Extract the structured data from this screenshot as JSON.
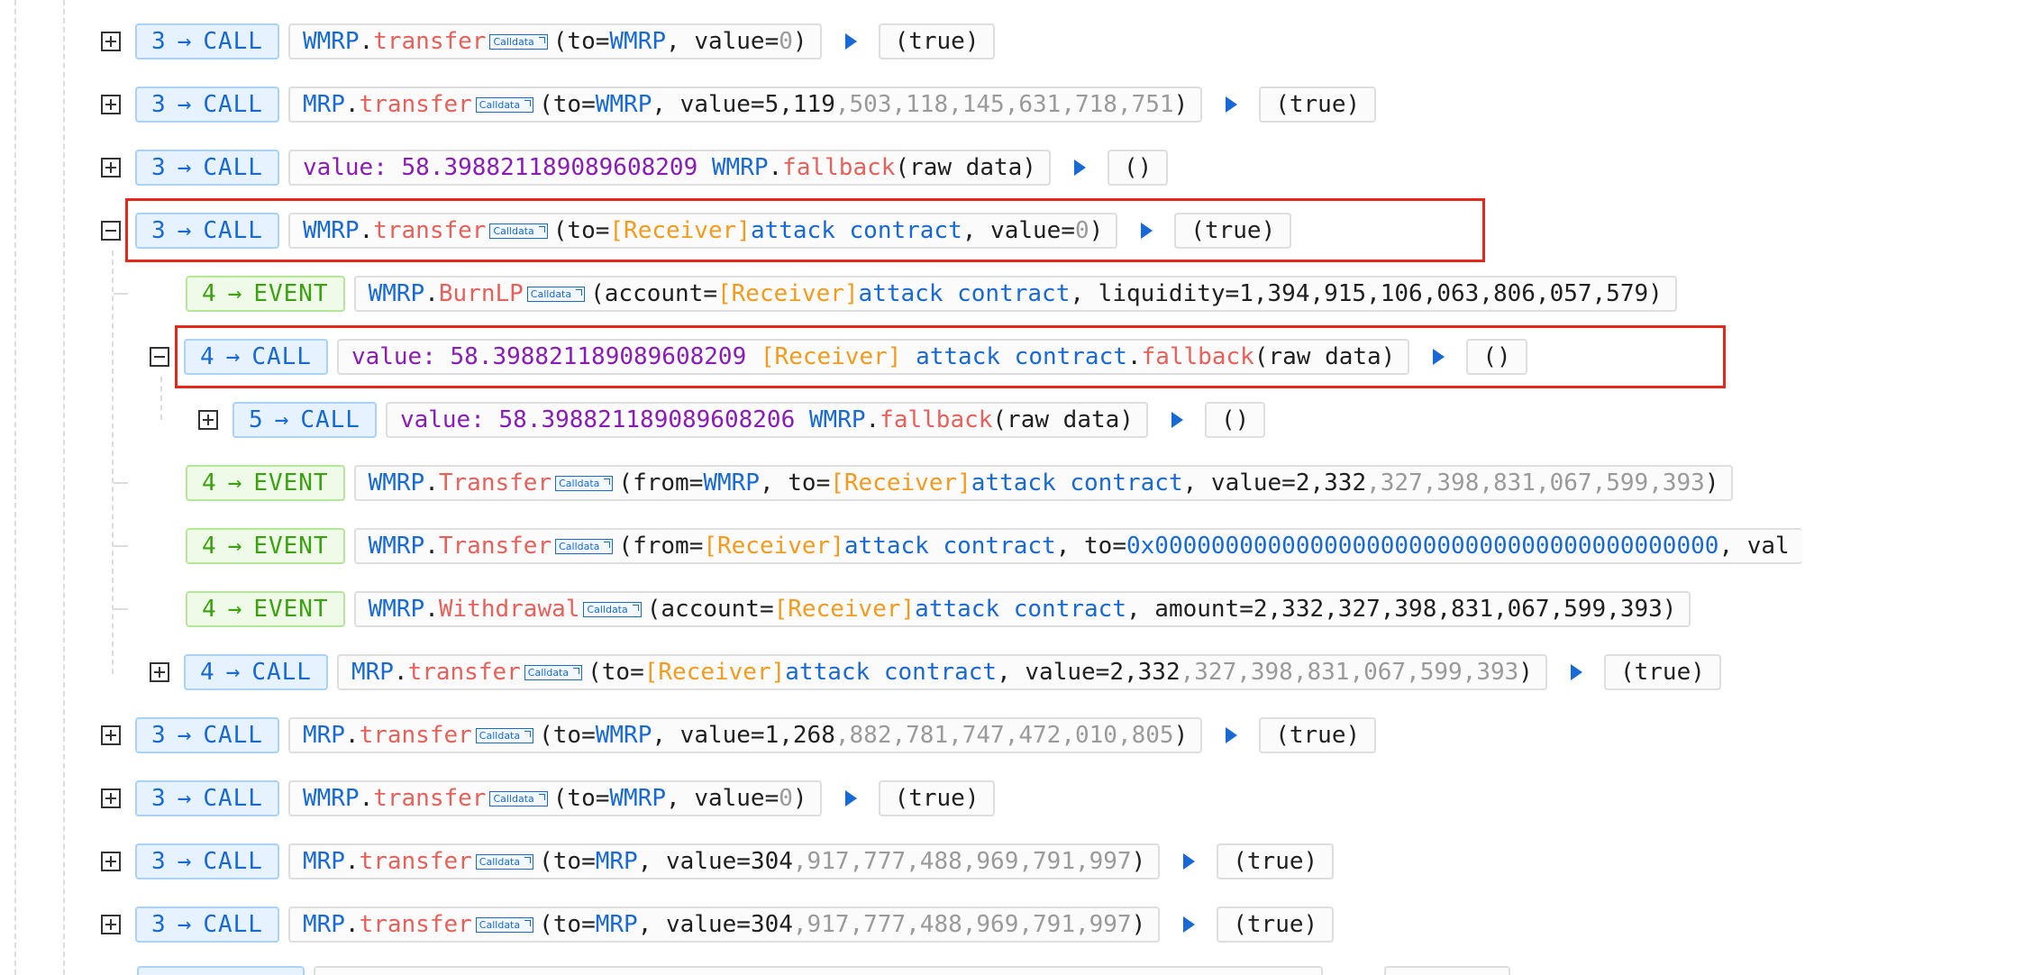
{
  "badge_arrow": "→",
  "calldata_label": "Calldata",
  "receiver": "[Receiver]",
  "attack_contract": "attack contract",
  "rows": [
    {
      "depth": "3",
      "type": "CALL",
      "pre": "",
      "contract": "WMRP",
      "method": "transfer",
      "args_open": "(to=",
      "a1": "WMRP",
      "a2": ", value=",
      "v_dark": "",
      "v_gray": "0",
      "close": ")",
      "result": "(true)"
    },
    {
      "depth": "3",
      "type": "CALL",
      "pre": "",
      "contract": "MRP",
      "method": "transfer",
      "args_open": "(to=",
      "a1": "WMRP",
      "a2": ", value=",
      "v_dark": "5,119",
      "v_gray": ",503,118,145,631,718,751",
      "close": ")",
      "result": "(true)"
    },
    {
      "depth": "3",
      "type": "CALL",
      "value_label": "value: 58.398821189089608209",
      "contract": "WMRP",
      "method": "fallback",
      "args": "(raw data)",
      "result": "()"
    },
    {
      "depth": "3",
      "type": "CALL",
      "contract": "WMRP",
      "method": "transfer",
      "args_open": "(to=",
      "a2": ", value=",
      "v_gray": "0",
      "close": ")",
      "result": "(true)"
    },
    {
      "depth": "4",
      "type": "EVENT",
      "contract": "WMRP",
      "method": "BurnLP",
      "args_open": "(account=",
      "a2": ", liquidity=1,394,915,106,063,806,057,579)"
    },
    {
      "depth": "4",
      "type": "CALL",
      "value_label": "value: 58.398821189089608209",
      "contract_tail": "contract",
      "method": "fallback",
      "args": "(raw data)",
      "result": "()"
    },
    {
      "depth": "5",
      "type": "CALL",
      "value_label": "value: 58.398821189089608206",
      "contract": "WMRP",
      "method": "fallback",
      "args": "(raw data)",
      "result": "()"
    },
    {
      "depth": "4",
      "type": "EVENT",
      "contract": "WMRP",
      "method": "Transfer",
      "args_open": "(from=",
      "a1": "WMRP",
      "a2": ", to=",
      "a3": ", value=",
      "v_dark": "2,332",
      "v_gray": ",327,398,831,067,599,393",
      "close": ")"
    },
    {
      "depth": "4",
      "type": "EVENT",
      "contract": "WMRP",
      "method": "Transfer",
      "args_open": "(from=",
      "a2": ", to=",
      "zero_addr": "0x0000000000000000000000000000000000000000",
      "tail": ", val"
    },
    {
      "depth": "4",
      "type": "EVENT",
      "contract": "WMRP",
      "method": "Withdrawal",
      "args_open": "(account=",
      "a2": ", amount=2,332,327,398,831,067,599,393)"
    },
    {
      "depth": "4",
      "type": "CALL",
      "contract": "MRP",
      "method": "transfer",
      "args_open": "(to=",
      "a2": ", value=",
      "v_dark": "2,332",
      "v_gray": ",327,398,831,067,599,393",
      "close": ")",
      "result": "(true)"
    },
    {
      "depth": "3",
      "type": "CALL",
      "contract": "MRP",
      "method": "transfer",
      "args_open": "(to=",
      "a1": "WMRP",
      "a2": ", value=",
      "v_dark": "1,268",
      "v_gray": ",882,781,747,472,010,805",
      "close": ")",
      "result": "(true)"
    },
    {
      "depth": "3",
      "type": "CALL",
      "contract": "WMRP",
      "method": "transfer",
      "args_open": "(to=",
      "a1": "WMRP",
      "a2": ", value=",
      "v_gray": "0",
      "close": ")",
      "result": "(true)"
    },
    {
      "depth": "3",
      "type": "CALL",
      "contract": "MRP",
      "method": "transfer",
      "args_open": "(to=",
      "a1": "MRP",
      "a2": ", value=",
      "v_dark": "304",
      "v_gray": ",917,777,488,969,791,997",
      "close": ")",
      "result": "(true)"
    },
    {
      "depth": "3",
      "type": "CALL",
      "contract": "MRP",
      "method": "transfer",
      "args_open": "(to=",
      "a1": "MRP",
      "a2": ", value=",
      "v_dark": "304",
      "v_gray": ",917,777,488,969,791,997",
      "close": ")",
      "result": "(true)"
    }
  ]
}
